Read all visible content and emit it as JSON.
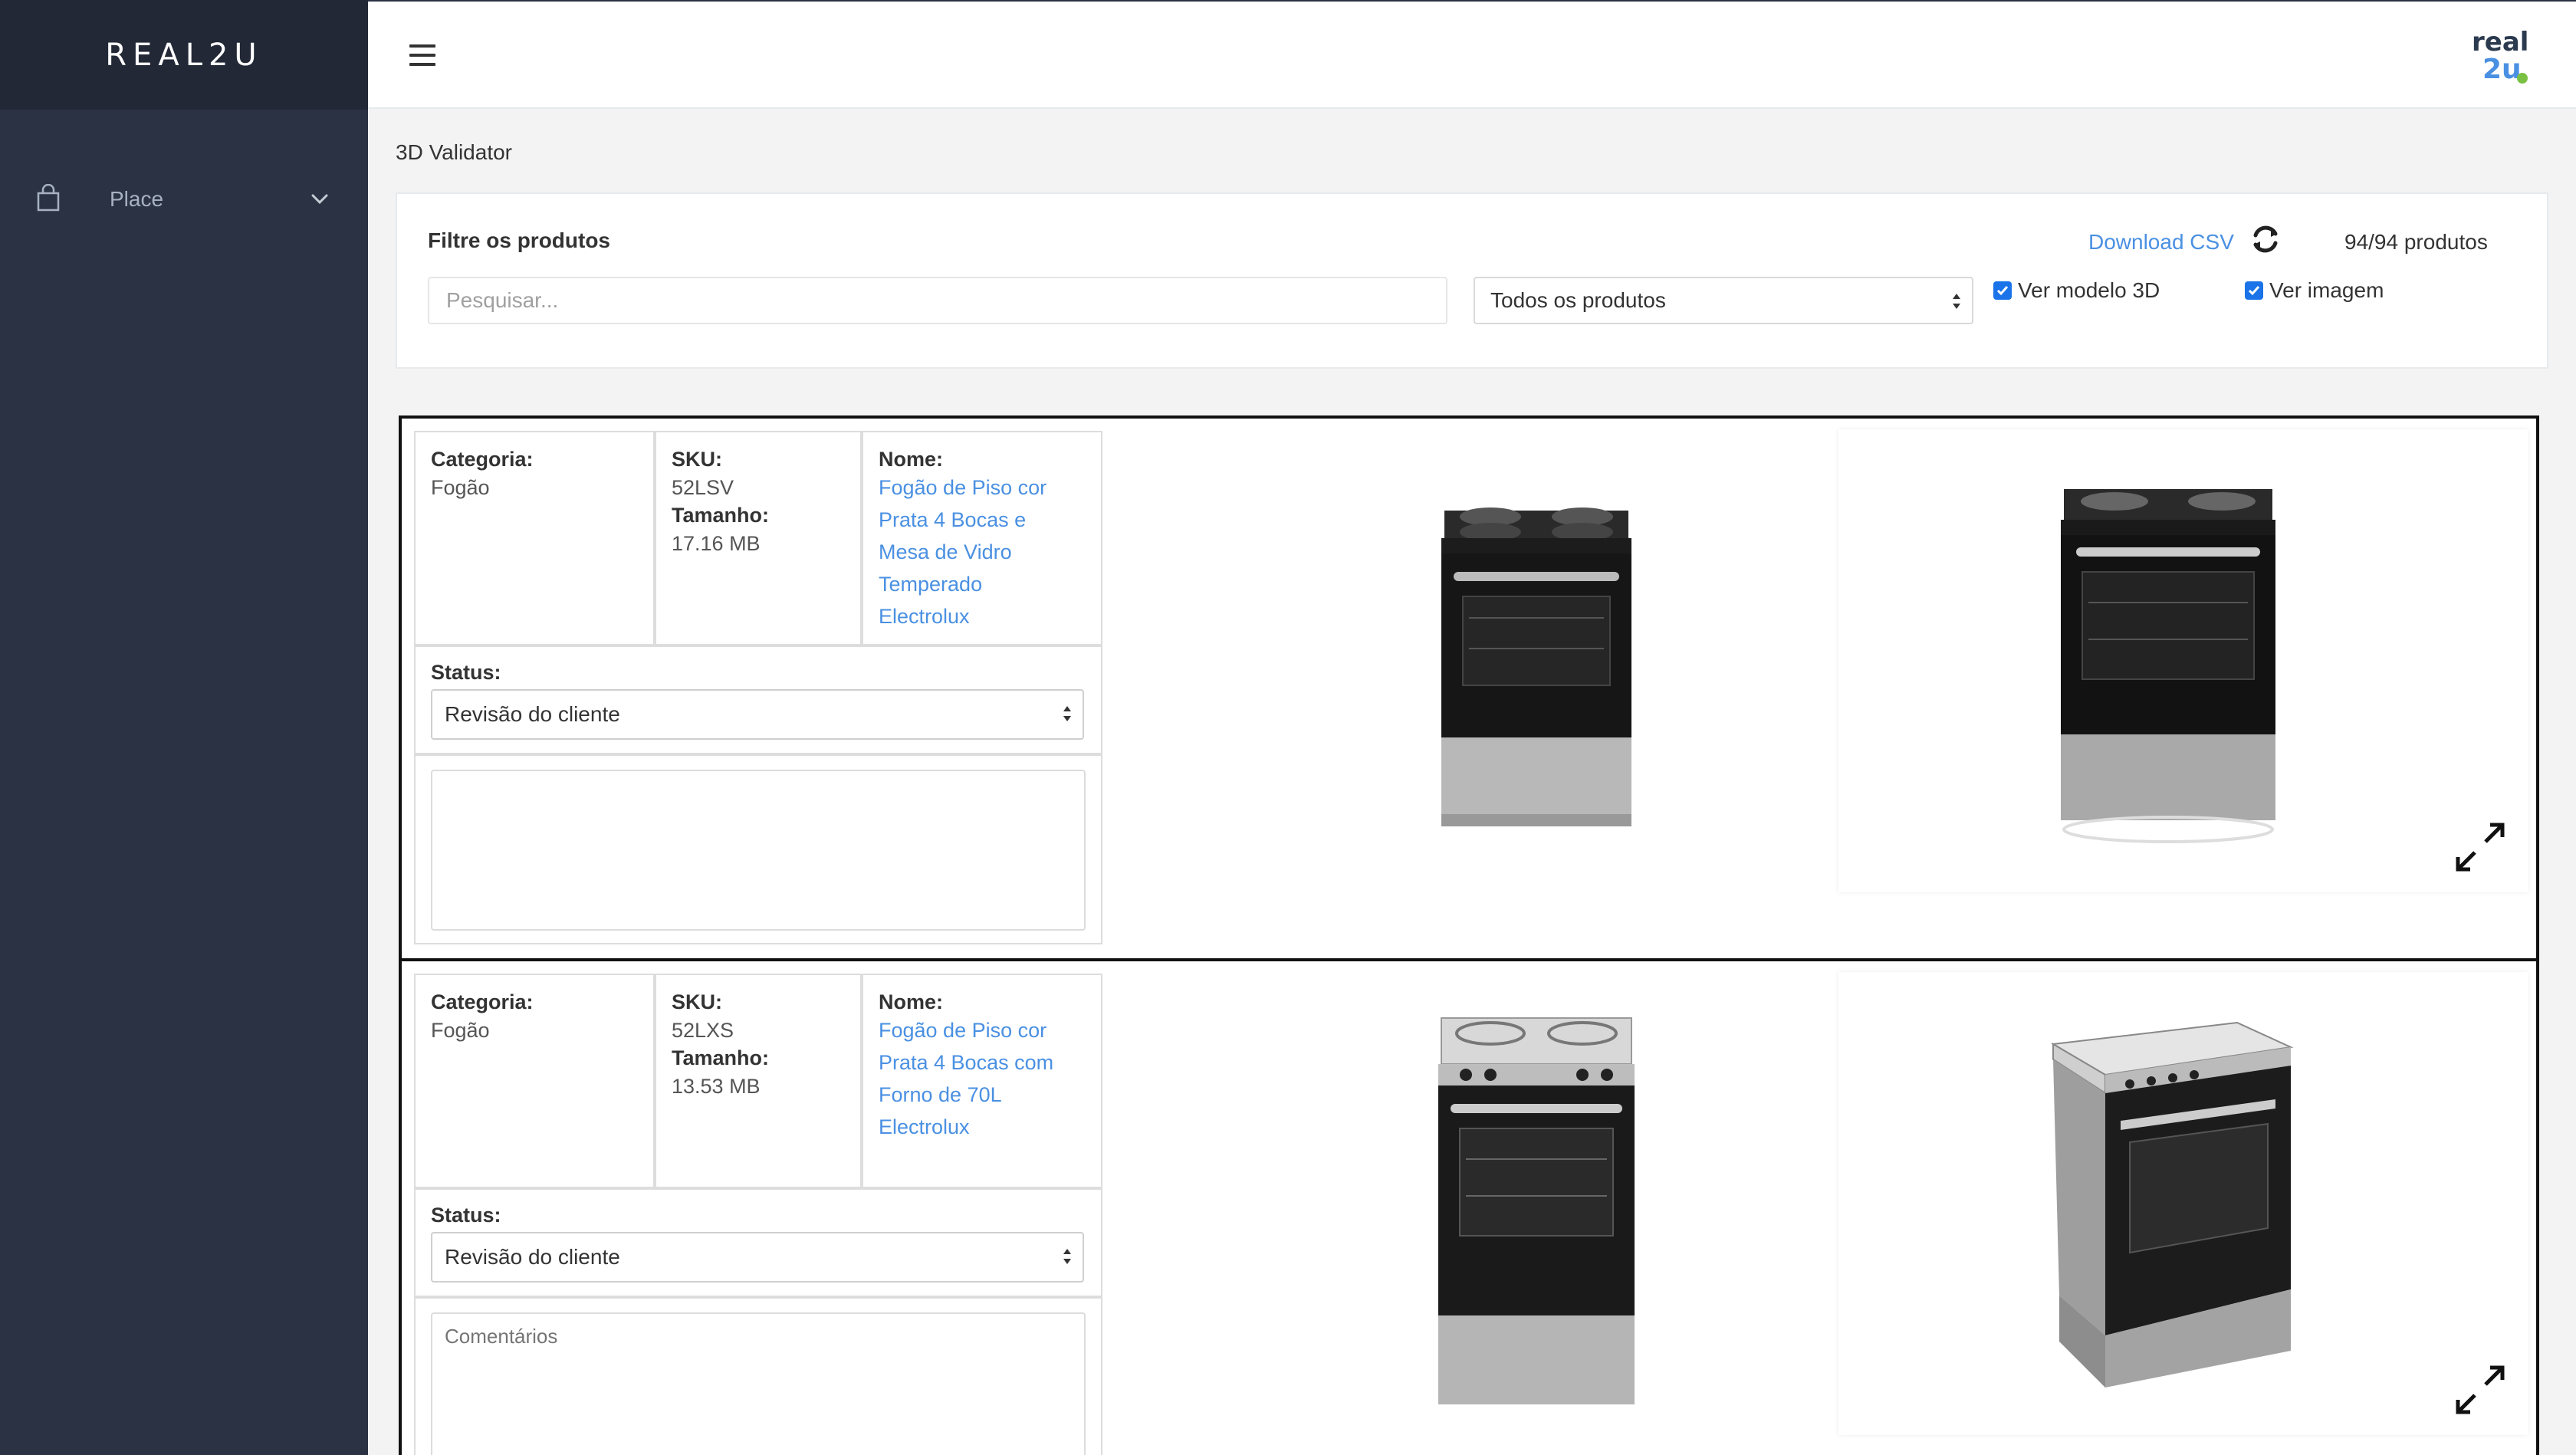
{
  "sidebar": {
    "brand": "REAL2U",
    "items": [
      {
        "label": "Place",
        "icon": "shopping-bag-icon"
      }
    ]
  },
  "header": {
    "menu_icon": "hamburger-icon",
    "logo_text": "real2u"
  },
  "page": {
    "title": "3D Validator"
  },
  "filter": {
    "title": "Filtre os produtos",
    "download_label": "Download CSV",
    "count": "94/94 produtos",
    "search_placeholder": "Pesquisar...",
    "product_filter_value": "Todos os produtos",
    "show_3d_label": "Ver modelo 3D",
    "show_3d_checked": true,
    "show_image_label": "Ver imagem",
    "show_image_checked": true
  },
  "labels": {
    "category": "Categoria:",
    "sku": "SKU:",
    "size": "Tamanho:",
    "name": "Nome:",
    "status": "Status:",
    "comments_placeholder": "Comentários"
  },
  "products": [
    {
      "category": "Fogão",
      "sku": "52LSV",
      "size": "17.16 MB",
      "name_lines": [
        "Fogão de Piso cor",
        "Prata 4 Bocas e",
        "Mesa de Vidro",
        "Temperado",
        "Electrolux"
      ],
      "status": "Revisão do cliente",
      "comment": ""
    },
    {
      "category": "Fogão",
      "sku": "52LXS",
      "size": "13.53 MB",
      "name_lines": [
        "Fogão de Piso cor",
        "Prata 4 Bocas com",
        "Forno de 70L",
        "Electrolux"
      ],
      "status": "Revisão do cliente",
      "comment": ""
    }
  ],
  "colors": {
    "sidebar": "#2b3244",
    "sidebar_header": "#222836",
    "link": "#4a90e2",
    "checkbox": "#1a73e8"
  }
}
